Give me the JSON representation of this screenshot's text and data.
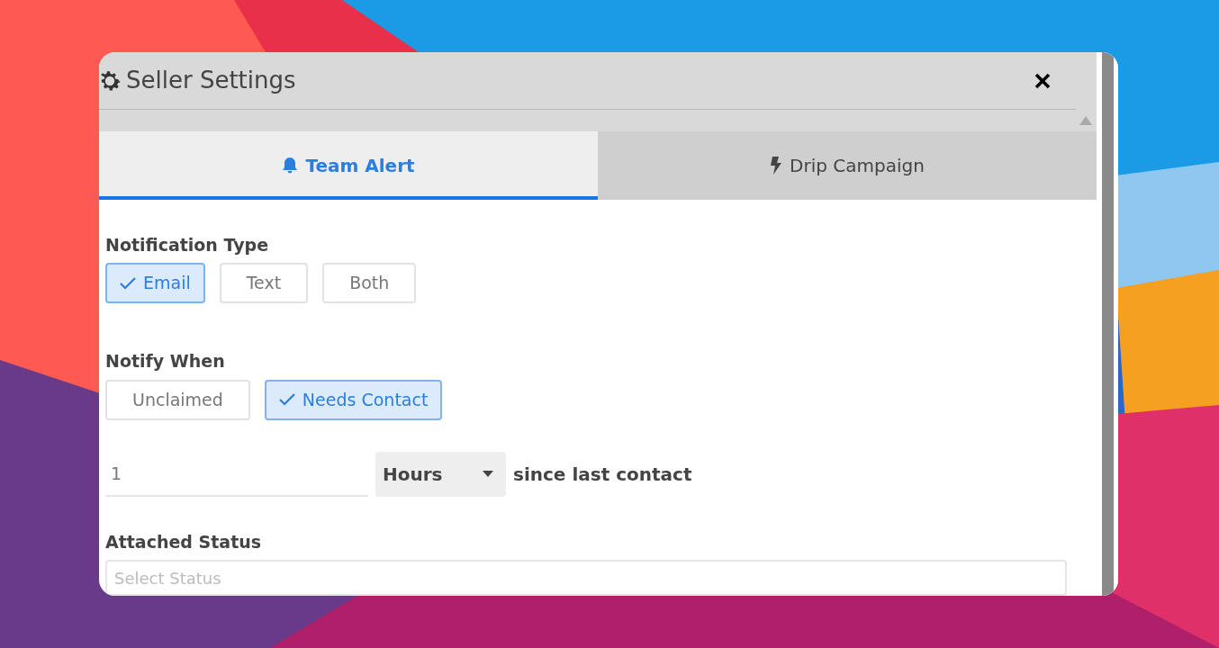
{
  "window": {
    "title": "Seller Settings"
  },
  "tabs": [
    {
      "label": "Team Alert",
      "selected": true
    },
    {
      "label": "Drip Campaign",
      "selected": false
    }
  ],
  "notification_type": {
    "label": "Notification Type",
    "options": [
      {
        "label": "Email",
        "selected": true
      },
      {
        "label": "Text",
        "selected": false
      },
      {
        "label": "Both",
        "selected": false
      }
    ]
  },
  "notify_when": {
    "label": "Notify When",
    "options": [
      {
        "label": "Unclaimed",
        "selected": false
      },
      {
        "label": "Needs Contact",
        "selected": true
      }
    ]
  },
  "delay": {
    "value": "1",
    "unit": "Hours",
    "suffix": "since last contact"
  },
  "attached_status": {
    "label": "Attached Status",
    "placeholder": "Select Status"
  }
}
